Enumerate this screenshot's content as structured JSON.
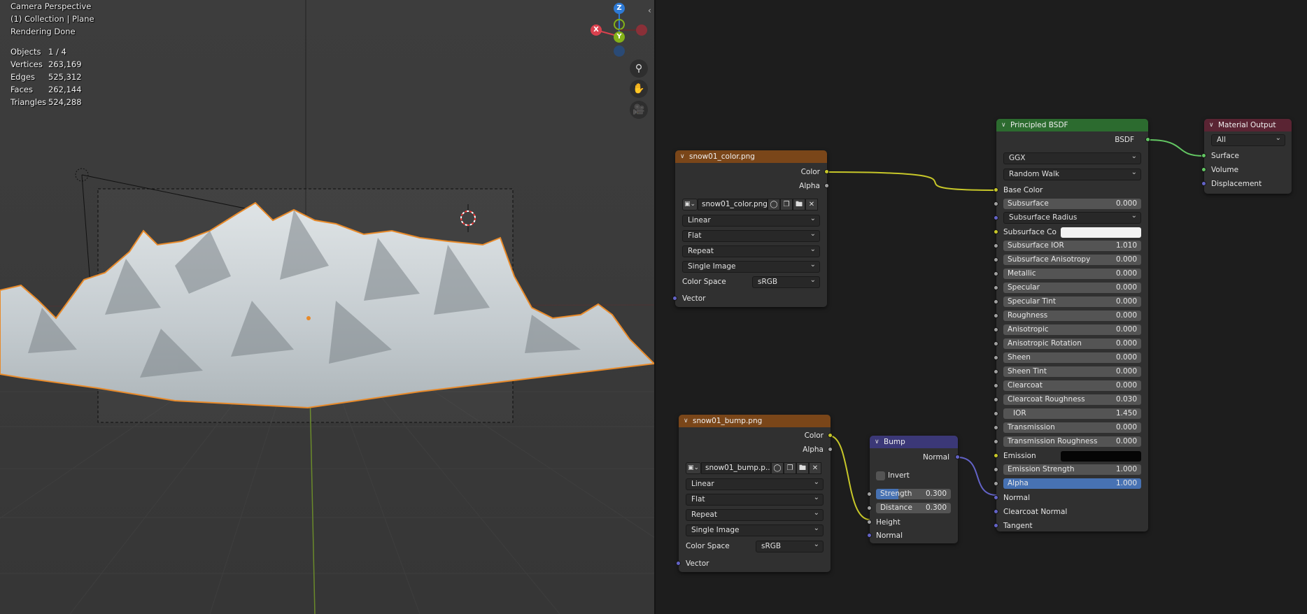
{
  "viewport": {
    "header_lines": [
      "Camera Perspective",
      "(1) Collection | Plane",
      "Rendering Done"
    ],
    "stats": [
      {
        "label": "Objects",
        "value": "1 / 4"
      },
      {
        "label": "Vertices",
        "value": "263,169"
      },
      {
        "label": "Edges",
        "value": "525,312"
      },
      {
        "label": "Faces",
        "value": "262,144"
      },
      {
        "label": "Triangles",
        "value": "524,288"
      }
    ],
    "gizmo": {
      "z": "Z",
      "x": "X",
      "y": "Y"
    },
    "colors": {
      "terrain_outline": "#e88a2a",
      "x_axis": "#d9414e",
      "y_axis": "#84b218",
      "z_axis": "#2d7ad6"
    }
  },
  "nodes": {
    "color_tex": {
      "title": "snow01_color.png",
      "out_color": "Color",
      "out_alpha": "Alpha",
      "image_name": "snow01_color.png",
      "interpolation": "Linear",
      "projection": "Flat",
      "extension": "Repeat",
      "source": "Single Image",
      "color_space_label": "Color Space",
      "color_space": "sRGB",
      "in_vector": "Vector"
    },
    "bump_tex": {
      "title": "snow01_bump.png",
      "out_color": "Color",
      "out_alpha": "Alpha",
      "image_name": "snow01_bump.p...",
      "interpolation": "Linear",
      "projection": "Flat",
      "extension": "Repeat",
      "source": "Single Image",
      "color_space_label": "Color Space",
      "color_space": "sRGB",
      "in_vector": "Vector"
    },
    "bump": {
      "title": "Bump",
      "out_normal": "Normal",
      "invert": "Invert",
      "strength_label": "Strength",
      "strength": "0.300",
      "strength_fraction": 0.3,
      "distance_label": "Distance",
      "distance": "0.300",
      "in_height": "Height",
      "in_normal": "Normal"
    },
    "bsdf": {
      "title": "Principled BSDF",
      "out_bsdf": "BSDF",
      "distribution": "GGX",
      "subsurface_method": "Random Walk",
      "base_color": "Base Color",
      "subsurface": {
        "label": "Subsurface",
        "value": "0.000"
      },
      "subsurface_radius": "Subsurface Radius",
      "subsurface_color": "Subsurface Co",
      "fields": [
        {
          "label": "Subsurface IOR",
          "value": "1.010"
        },
        {
          "label": "Subsurface Anisotropy",
          "value": "0.000"
        },
        {
          "label": "Metallic",
          "value": "0.000"
        },
        {
          "label": "Specular",
          "value": "0.000"
        },
        {
          "label": "Specular Tint",
          "value": "0.000"
        },
        {
          "label": "Roughness",
          "value": "0.000"
        },
        {
          "label": "Anisotropic",
          "value": "0.000"
        },
        {
          "label": "Anisotropic Rotation",
          "value": "0.000"
        },
        {
          "label": "Sheen",
          "value": "0.000"
        },
        {
          "label": "Sheen Tint",
          "value": "0.000"
        },
        {
          "label": "Clearcoat",
          "value": "0.000"
        },
        {
          "label": "Clearcoat Roughness",
          "value": "0.030"
        },
        {
          "label": "IOR",
          "value": "1.450"
        },
        {
          "label": "Transmission",
          "value": "0.000"
        },
        {
          "label": "Transmission Roughness",
          "value": "0.000"
        }
      ],
      "emission": "Emission",
      "emission_strength": {
        "label": "Emission Strength",
        "value": "1.000"
      },
      "alpha": {
        "label": "Alpha",
        "value": "1.000"
      },
      "normal": "Normal",
      "clearcoat_normal": "Clearcoat Normal",
      "tangent": "Tangent"
    },
    "output": {
      "title": "Material Output",
      "target": "All",
      "surface": "Surface",
      "volume": "Volume",
      "displacement": "Displacement"
    }
  }
}
